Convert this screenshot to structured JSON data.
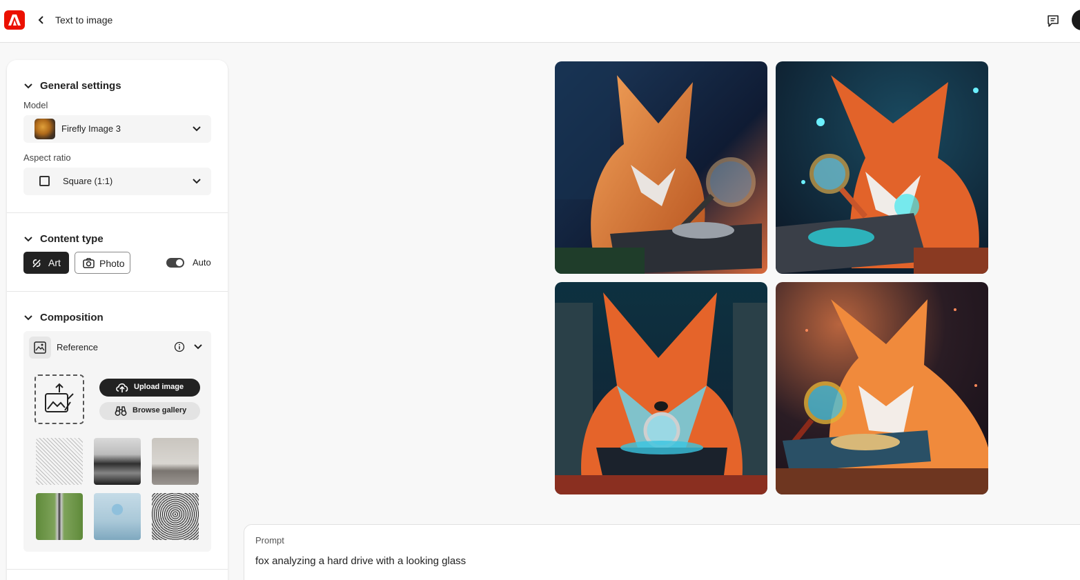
{
  "header": {
    "title": "Text to image"
  },
  "panel": {
    "general_settings": {
      "heading": "General settings",
      "model_label": "Model",
      "model_value": "Firefly Image 3",
      "aspect_label": "Aspect ratio",
      "aspect_value": "Square (1:1)"
    },
    "content_type": {
      "heading": "Content type",
      "art_label": "Art",
      "photo_label": "Photo",
      "auto_label": "Auto",
      "selected": "Art",
      "auto_enabled": true
    },
    "composition": {
      "heading": "Composition",
      "reference_label": "Reference",
      "upload_label": "Upload image",
      "browse_label": "Browse gallery",
      "thumbnails": [
        "bird-sketch",
        "mountain-landscape",
        "living-room",
        "road-field",
        "sphere-cube",
        "owl-sketch"
      ]
    }
  },
  "results": {
    "images": [
      "fox-with-magnifier-1",
      "fox-with-magnifier-2",
      "fox-with-magnifier-3",
      "fox-with-magnifier-4"
    ]
  },
  "prompt": {
    "label": "Prompt",
    "value": "fox analyzing a hard drive with a looking glass"
  },
  "colors": {
    "brand": "#eb1000",
    "dark": "#222222"
  }
}
